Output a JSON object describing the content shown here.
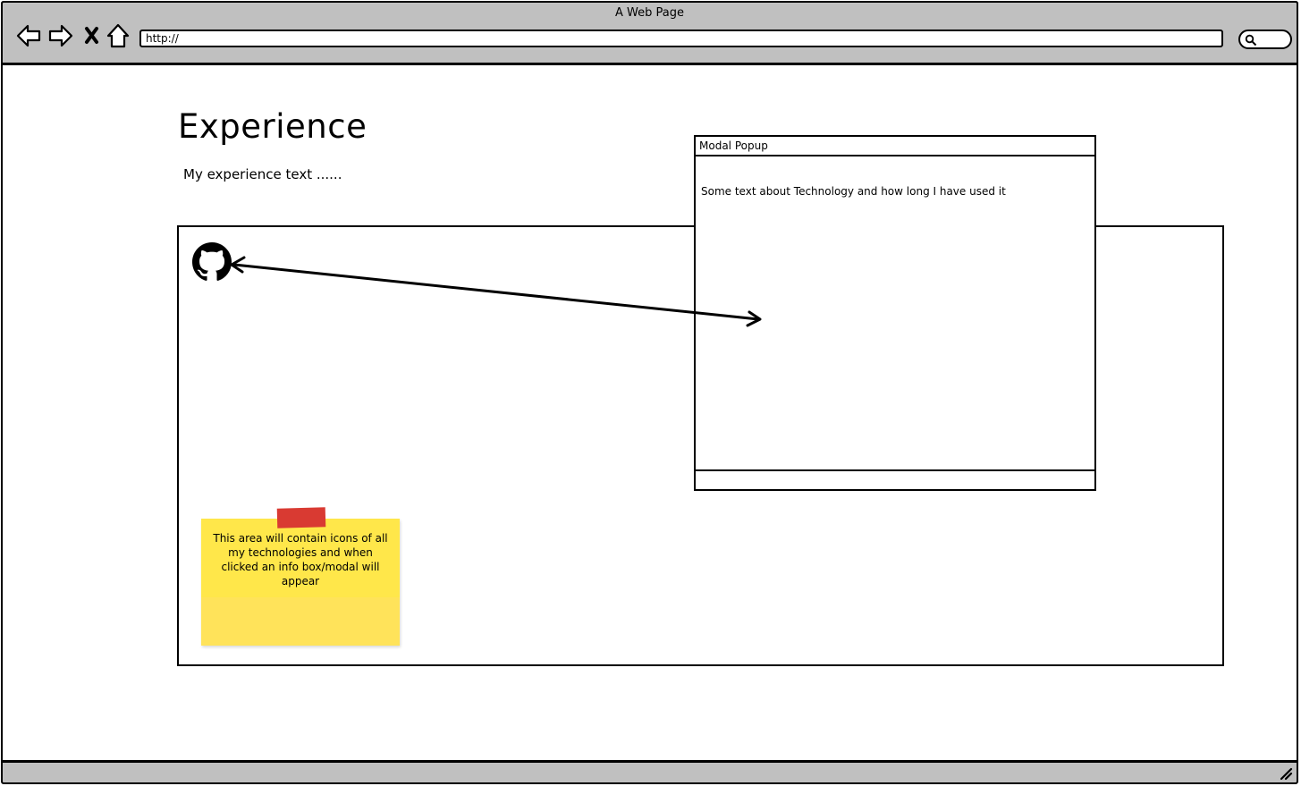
{
  "window": {
    "title": "A Web Page"
  },
  "browser": {
    "url": "http://",
    "nav": [
      "back-icon",
      "forward-icon",
      "close-icon",
      "home-icon"
    ],
    "search_icon": "search-icon"
  },
  "page": {
    "title": "Experience",
    "text": "My experience text ......"
  },
  "content_area": {
    "icon": "github-icon"
  },
  "modal": {
    "title": "Modal Popup",
    "body": "Some text about Technology and how long I have used it"
  },
  "sticky_note": {
    "text": "This area will contain icons of all my technologies and when clicked an info box/modal will appear",
    "color": "#ffe74a",
    "tape_color": "#d93a32"
  },
  "statusbar": {
    "resize_icon": "resize-grip-icon"
  }
}
